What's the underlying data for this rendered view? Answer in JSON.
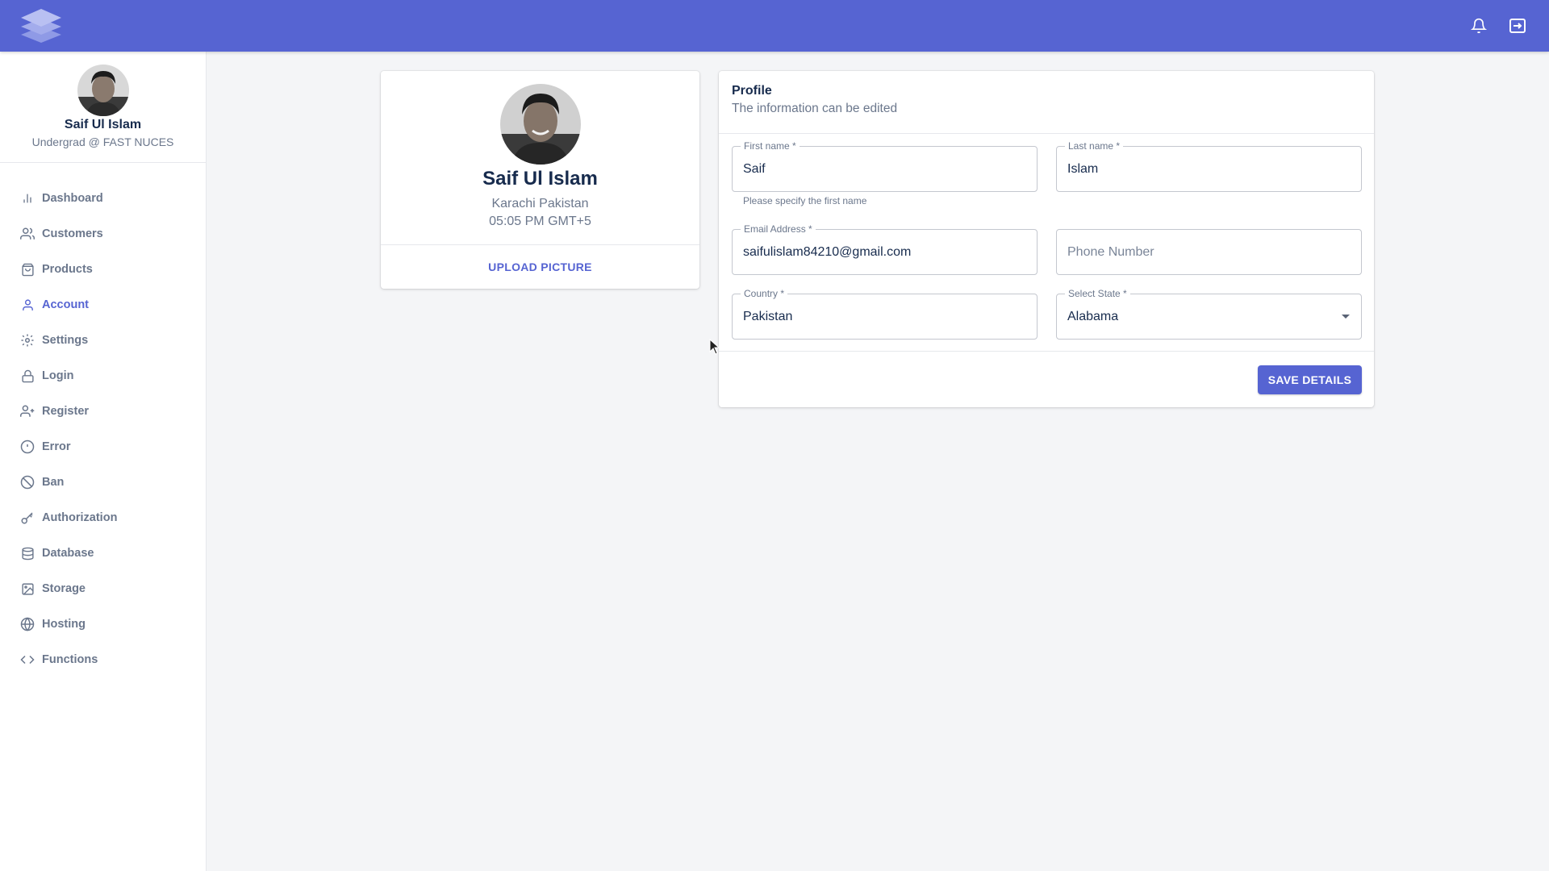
{
  "topbar": {
    "logo_icon": "layers-logo-icon",
    "notifications_icon": "bell-icon",
    "logout_icon": "logout-icon",
    "accent_color": "#5664d2"
  },
  "sidebar": {
    "user_name": "Saif Ul Islam",
    "user_subtitle": "Undergrad @ FAST NUCES",
    "items": [
      {
        "label": "Dashboard",
        "icon": "bar-chart-icon",
        "active": false
      },
      {
        "label": "Customers",
        "icon": "users-icon",
        "active": false
      },
      {
        "label": "Products",
        "icon": "shopping-bag-icon",
        "active": false
      },
      {
        "label": "Account",
        "icon": "user-icon",
        "active": true
      },
      {
        "label": "Settings",
        "icon": "settings-icon",
        "active": false
      },
      {
        "label": "Login",
        "icon": "lock-icon",
        "active": false
      },
      {
        "label": "Register",
        "icon": "user-plus-icon",
        "active": false
      },
      {
        "label": "Error",
        "icon": "alert-circle-icon",
        "active": false
      },
      {
        "label": "Ban",
        "icon": "ban-icon",
        "active": false
      },
      {
        "label": "Authorization",
        "icon": "key-icon",
        "active": false
      },
      {
        "label": "Database",
        "icon": "database-icon",
        "active": false
      },
      {
        "label": "Storage",
        "icon": "image-icon",
        "active": false
      },
      {
        "label": "Hosting",
        "icon": "globe-icon",
        "active": false
      },
      {
        "label": "Functions",
        "icon": "code-icon",
        "active": false
      }
    ]
  },
  "profile_card": {
    "name": "Saif Ul Islam",
    "location": "Karachi Pakistan",
    "time": "05:05 PM GMT+5",
    "upload_label": "UPLOAD PICTURE"
  },
  "form": {
    "title": "Profile",
    "subtitle": "The information can be edited",
    "first_name": {
      "label": "First name *",
      "value": "Saif",
      "helper": "Please specify the first name"
    },
    "last_name": {
      "label": "Last name *",
      "value": "Islam"
    },
    "email": {
      "label": "Email Address *",
      "value": "saifulislam84210@gmail.com"
    },
    "phone": {
      "placeholder": "Phone Number"
    },
    "country": {
      "label": "Country *",
      "value": "Pakistan"
    },
    "state": {
      "label": "Select State *",
      "value": "Alabama"
    },
    "save_label": "SAVE DETAILS"
  }
}
